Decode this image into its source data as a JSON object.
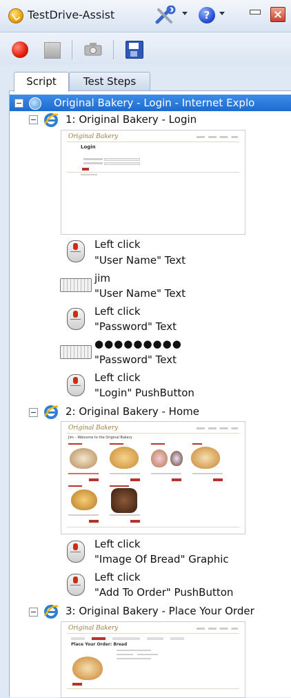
{
  "app": {
    "title": "TestDrive-Assist"
  },
  "tabs": [
    {
      "label": "Script"
    },
    {
      "label": "Test Steps"
    }
  ],
  "tree": {
    "root_label": "Original Bakery - Login - Internet Explo",
    "pages": [
      {
        "label": "1: Original Bakery - Login",
        "thumbnail": {
          "logo": "Original Bakery",
          "heading": "Login"
        },
        "steps": [
          {
            "action": "Left click",
            "target": "\"User Name\" Text",
            "icon": "mouse-icon"
          },
          {
            "action": "jim",
            "target": "\"User Name\" Text",
            "icon": "keyboard-icon"
          },
          {
            "action": "Left click",
            "target": "\"Password\" Text",
            "icon": "mouse-icon"
          },
          {
            "action": "●●●●●●●●●",
            "target": "\"Password\" Text",
            "icon": "keyboard-icon"
          },
          {
            "action": "Left click",
            "target": "\"Login\" PushButton",
            "icon": "mouse-icon"
          }
        ]
      },
      {
        "label": "2: Original Bakery - Home",
        "thumbnail": {
          "logo": "Original Bakery",
          "heading": "Jim – Welcome to the Original Bakery"
        },
        "steps": [
          {
            "action": "Left click",
            "target": "\"Image Of Bread\" Graphic",
            "icon": "mouse-icon"
          },
          {
            "action": "Left click",
            "target": "\"Add To Order\" PushButton",
            "icon": "mouse-icon"
          }
        ]
      },
      {
        "label": "3: Original Bakery - Place Your Order",
        "thumbnail": {
          "logo": "Original Bakery",
          "heading": "Place Your Order: Bread"
        },
        "steps": []
      }
    ]
  },
  "colors": {
    "selection": "#1d6bd0",
    "record": "#e01b0b",
    "accent_red": "#b5332a"
  }
}
